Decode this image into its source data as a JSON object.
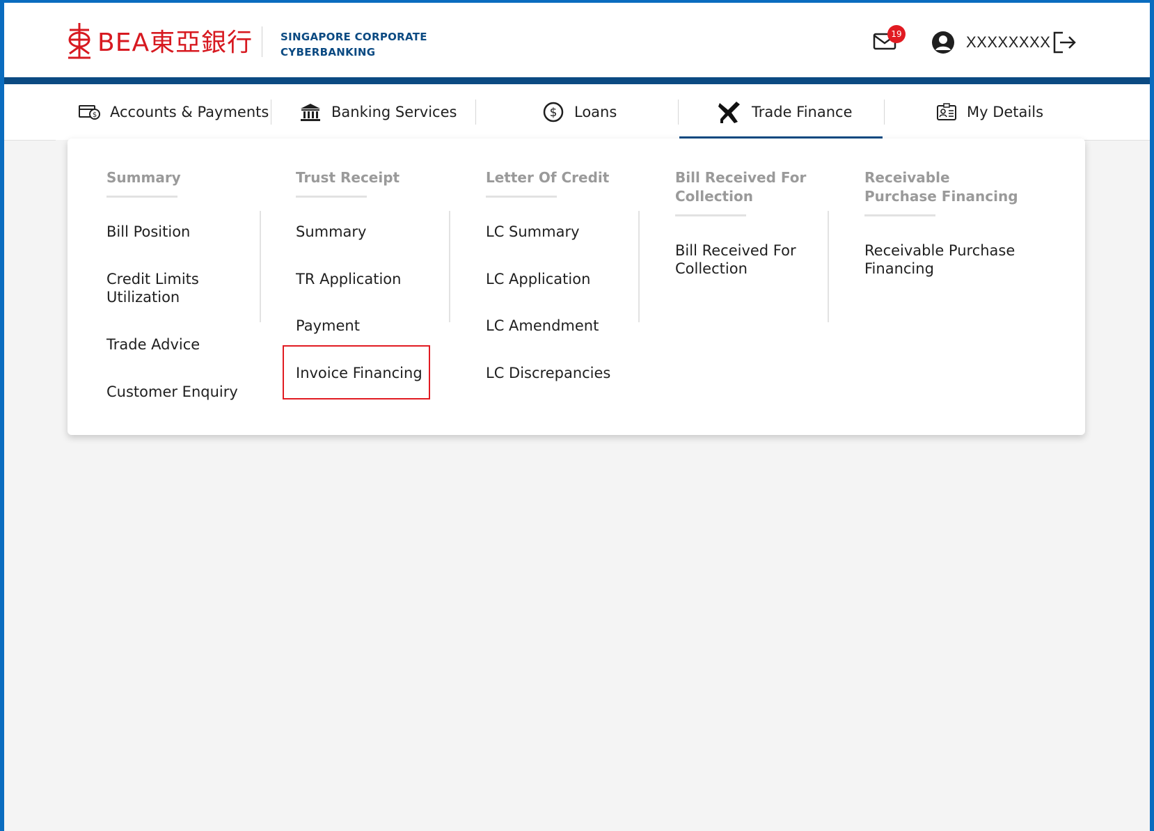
{
  "header": {
    "logo_text": "BEA東亞銀行",
    "subtitle_line1": "SINGAPORE CORPORATE",
    "subtitle_line2": "CYBERBANKING",
    "mail_count": "19",
    "username": "XXXXXXXX"
  },
  "nav": {
    "items": [
      {
        "label": "Accounts & Payments",
        "icon": "wallet-icon"
      },
      {
        "label": "Banking Services",
        "icon": "bank-icon"
      },
      {
        "label": "Loans",
        "icon": "dollar-coin-icon"
      },
      {
        "label": "Trade Finance",
        "icon": "airplane-icon",
        "active": true
      },
      {
        "label": "My Details",
        "icon": "id-card-icon"
      }
    ]
  },
  "dropdown": {
    "columns": [
      {
        "heading": "Summary",
        "items": [
          "Bill Position",
          "Credit Limits Utilization",
          "Trade Advice",
          "Customer Enquiry"
        ]
      },
      {
        "heading": "Trust Receipt",
        "items": [
          "Summary",
          "TR Application",
          "Payment",
          "Invoice Financing"
        ]
      },
      {
        "heading": "Letter Of Credit",
        "items": [
          "LC Summary",
          "LC Application",
          "LC Amendment",
          "LC Discrepancies"
        ]
      },
      {
        "heading": "Bill Received For Collection",
        "items": [
          "Bill Received For Collection"
        ]
      },
      {
        "heading": "Receivable Purchase Financing",
        "items": [
          "Receivable Purchase Financing"
        ]
      }
    ],
    "highlighted_item": "Invoice Financing"
  },
  "colors": {
    "brand_red": "#d71920",
    "brand_blue": "#0b4a82",
    "frame_blue": "#0a6cbf",
    "highlight_red": "#e11b22"
  }
}
